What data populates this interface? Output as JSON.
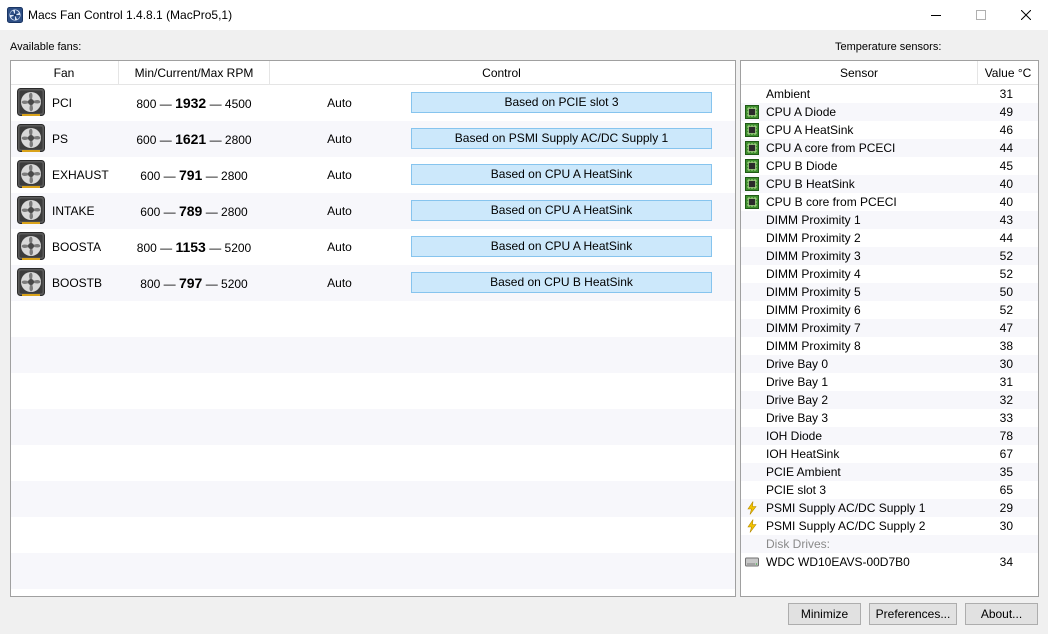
{
  "window": {
    "title": "Macs Fan Control 1.4.8.1 (MacPro5,1)"
  },
  "fans_section": {
    "label": "Available fans:",
    "headers": {
      "fan": "Fan",
      "rpm": "Min/Current/Max RPM",
      "control": "Control"
    },
    "rows": [
      {
        "name": "PCI",
        "min": "800 —",
        "current": "1932",
        "max": "— 4500",
        "mode": "Auto",
        "control": "Based on PCIE slot 3"
      },
      {
        "name": "PS",
        "min": "600 —",
        "current": "1621",
        "max": "— 2800",
        "mode": "Auto",
        "control": "Based on PSMI Supply AC/DC Supply 1"
      },
      {
        "name": "EXHAUST",
        "min": "600 —",
        "current": "791",
        "max": "— 2800",
        "mode": "Auto",
        "control": "Based on CPU A HeatSink"
      },
      {
        "name": "INTAKE",
        "min": "600 —",
        "current": "789",
        "max": "— 2800",
        "mode": "Auto",
        "control": "Based on CPU A HeatSink"
      },
      {
        "name": "BOOSTA",
        "min": "800 —",
        "current": "1153",
        "max": "— 5200",
        "mode": "Auto",
        "control": "Based on CPU A HeatSink"
      },
      {
        "name": "BOOSTB",
        "min": "800 —",
        "current": "797",
        "max": "— 5200",
        "mode": "Auto",
        "control": "Based on CPU B HeatSink"
      }
    ]
  },
  "sensors_section": {
    "label": "Temperature sensors:",
    "headers": {
      "sensor": "Sensor",
      "value": "Value °C"
    },
    "rows": [
      {
        "name": "Ambient",
        "value": "31",
        "icon": "none"
      },
      {
        "name": "CPU A Diode",
        "value": "49",
        "icon": "cpu-chip-icon"
      },
      {
        "name": "CPU A HeatSink",
        "value": "46",
        "icon": "cpu-chip-icon"
      },
      {
        "name": "CPU A core from PCECI",
        "value": "44",
        "icon": "cpu-chip-icon"
      },
      {
        "name": "CPU B Diode",
        "value": "45",
        "icon": "cpu-chip-icon"
      },
      {
        "name": "CPU B HeatSink",
        "value": "40",
        "icon": "cpu-chip-icon"
      },
      {
        "name": "CPU B core from PCECI",
        "value": "40",
        "icon": "cpu-chip-icon"
      },
      {
        "name": "DIMM Proximity 1",
        "value": "43",
        "icon": "none"
      },
      {
        "name": "DIMM Proximity 2",
        "value": "44",
        "icon": "none"
      },
      {
        "name": "DIMM Proximity 3",
        "value": "52",
        "icon": "none"
      },
      {
        "name": "DIMM Proximity 4",
        "value": "52",
        "icon": "none"
      },
      {
        "name": "DIMM Proximity 5",
        "value": "50",
        "icon": "none"
      },
      {
        "name": "DIMM Proximity 6",
        "value": "52",
        "icon": "none"
      },
      {
        "name": "DIMM Proximity 7",
        "value": "47",
        "icon": "none"
      },
      {
        "name": "DIMM Proximity 8",
        "value": "38",
        "icon": "none"
      },
      {
        "name": "Drive Bay 0",
        "value": "30",
        "icon": "none"
      },
      {
        "name": "Drive Bay 1",
        "value": "31",
        "icon": "none"
      },
      {
        "name": "Drive Bay 2",
        "value": "32",
        "icon": "none"
      },
      {
        "name": "Drive Bay 3",
        "value": "33",
        "icon": "none"
      },
      {
        "name": "IOH Diode",
        "value": "78",
        "icon": "none"
      },
      {
        "name": "IOH HeatSink",
        "value": "67",
        "icon": "none"
      },
      {
        "name": "PCIE Ambient",
        "value": "35",
        "icon": "none"
      },
      {
        "name": "PCIE slot 3",
        "value": "65",
        "icon": "none"
      },
      {
        "name": "PSMI Supply AC/DC Supply 1",
        "value": "29",
        "icon": "lightning-icon"
      },
      {
        "name": "PSMI Supply AC/DC Supply 2",
        "value": "30",
        "icon": "lightning-icon"
      },
      {
        "name": "Disk Drives:",
        "value": "",
        "icon": "none",
        "group": true
      },
      {
        "name": "WDC WD10EAVS-00D7B0",
        "value": "34",
        "icon": "hard-drive-icon"
      }
    ]
  },
  "buttons": {
    "minimize": "Minimize",
    "preferences": "Preferences...",
    "about": "About..."
  },
  "colors": {
    "control_fill": "#cce8fb",
    "control_border": "#86c4ee",
    "cpu_icon": "#3e8e2e",
    "lightning_icon": "#e8b400"
  }
}
